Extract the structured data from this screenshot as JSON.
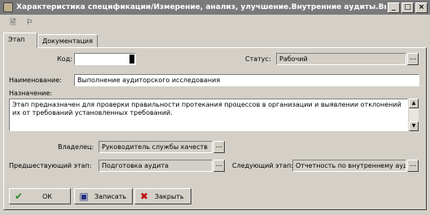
{
  "window": {
    "title": "Характеристика спецификации/Измерение, анализ, улучшение.Внутренние аудиты.Выпол...",
    "minimize": "_",
    "maximize": "□",
    "close": "×"
  },
  "toolbar": {
    "icon1": "🖹",
    "icon2": "⚐"
  },
  "tabs": [
    "Этап",
    "Документация"
  ],
  "form": {
    "code_label": "Код:",
    "code_value": "",
    "status_label": "Статус:",
    "status_value": "Рабочий",
    "name_label": "Наименование:",
    "name_value": "Выполнение аудиторского исследования",
    "purpose_label": "Назначение:",
    "purpose_value": "Этап предназначен для проверки правильности протекания процессов в организации и выявлении отклонений их от требований установленных требований.",
    "owner_label": "Владелец:",
    "owner_value": "Руководитель службы качеств",
    "prev_label": "Предшествующий этап:",
    "prev_value": "Подготовка аудита",
    "next_label": "Следующий этап:",
    "next_value": "Отчетность по внутреннему ауд"
  },
  "buttons": {
    "ok": "ОК",
    "save": "Записать",
    "close": "Закрыть"
  },
  "colors": {
    "ok_icon": "#2a8a2a",
    "close_icon": "#c01010",
    "save_icon": "#203080"
  }
}
